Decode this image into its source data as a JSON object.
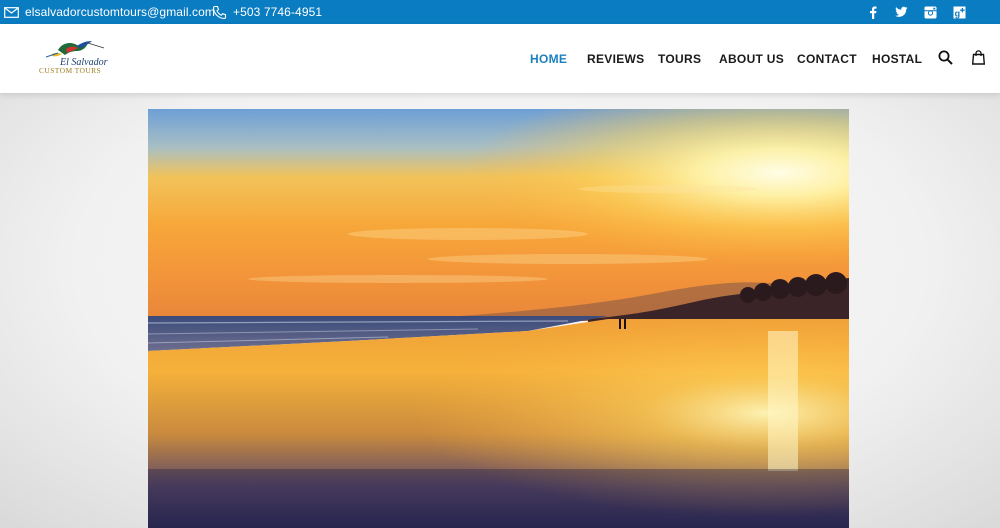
{
  "topbar": {
    "email": "elsalvadorcustomtours@gmail.com",
    "phone": "+503 7746-4951",
    "social_icons": [
      "facebook-icon",
      "twitter-icon",
      "instagram-icon",
      "google-plus-icon"
    ]
  },
  "logo": {
    "line1": "El Salvador",
    "line2": "CUSTOM TOURS"
  },
  "nav": {
    "items": [
      {
        "label": "HOME",
        "active": true
      },
      {
        "label": "REVIEWS",
        "active": false
      },
      {
        "label": "TOURS",
        "active": false
      },
      {
        "label": "ABOUT US",
        "active": false
      },
      {
        "label": "CONTACT",
        "active": false
      },
      {
        "label": "HOSTAL",
        "active": false
      }
    ],
    "icons": [
      "search-icon",
      "shopping-bag-icon"
    ]
  },
  "colors": {
    "topbar_bg": "#0a7cc1",
    "nav_active": "#1b7fc0",
    "nav_text": "#1a1a1a"
  }
}
